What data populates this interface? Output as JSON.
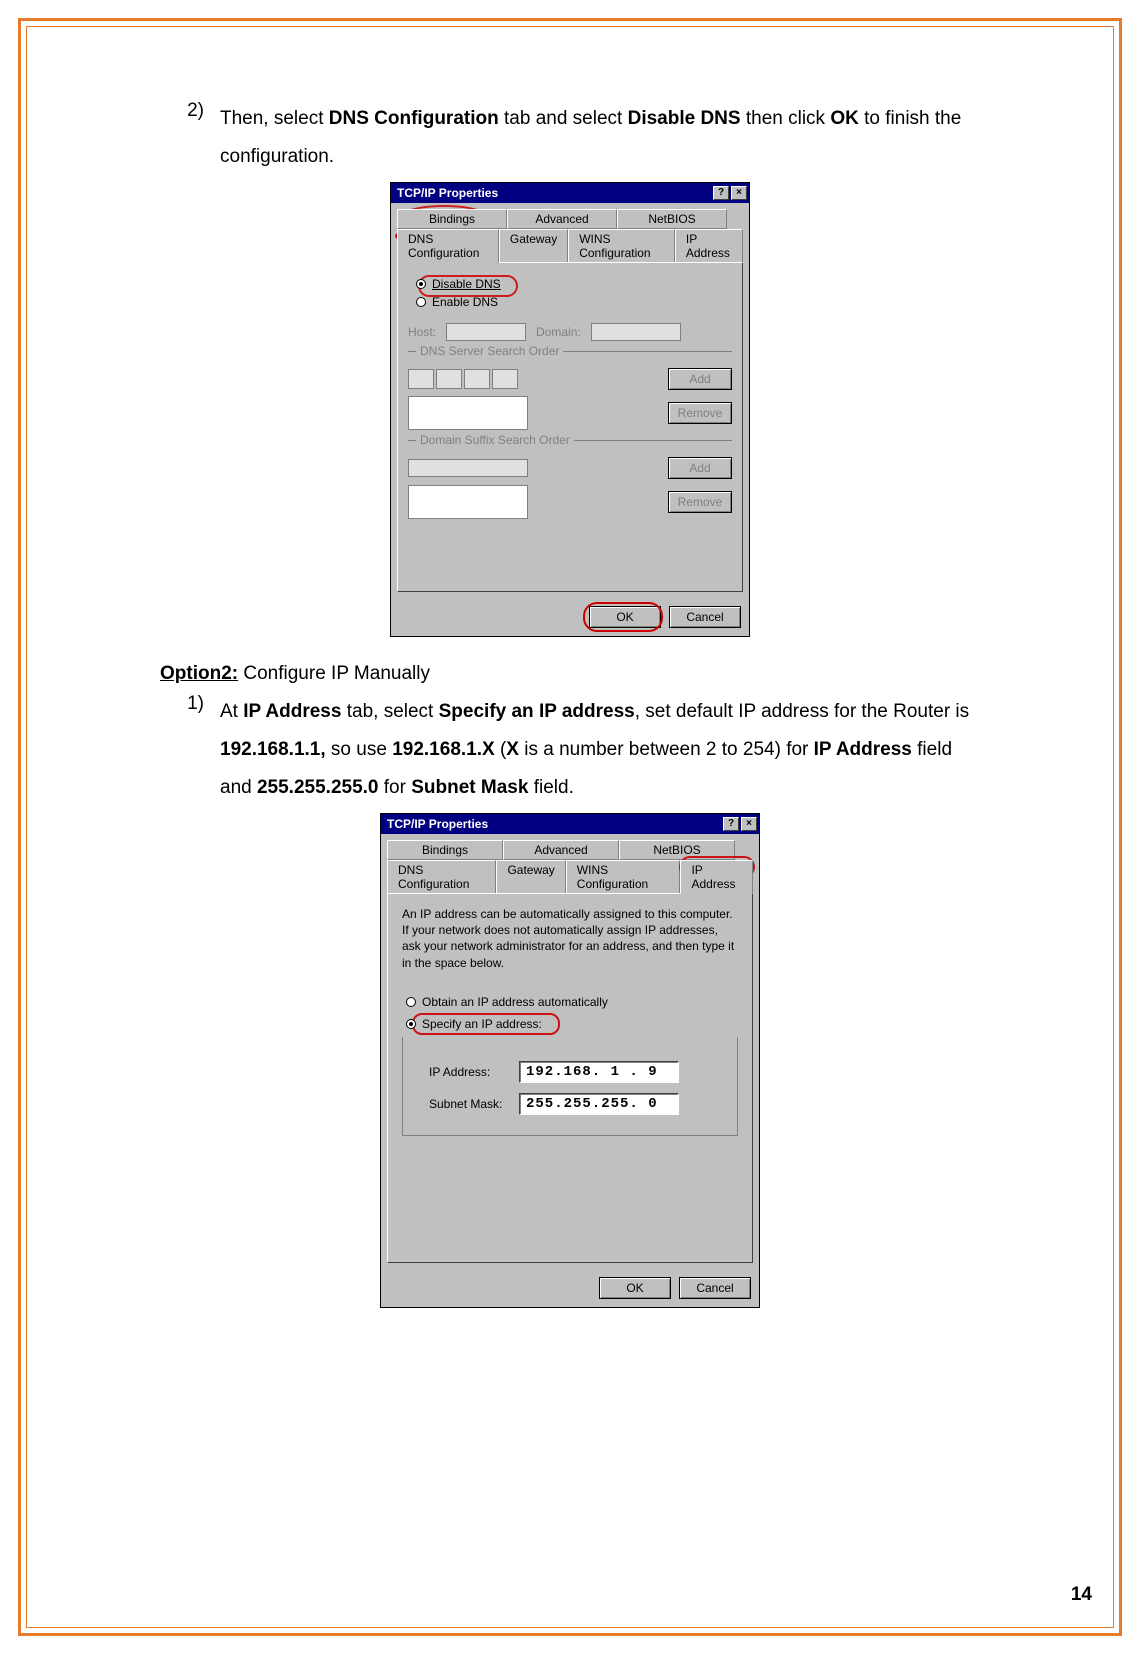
{
  "page_number": "14",
  "step2": {
    "num": "2)",
    "text_a": "Then, select ",
    "bold_a": "DNS Configuration",
    "text_b": " tab and select ",
    "bold_b": "Disable DNS",
    "text_c": " then click ",
    "bold_c": "OK",
    "text_d": " to finish the configuration."
  },
  "option2": {
    "label": "Option2:",
    "text": " Configure IP Manually"
  },
  "step1b": {
    "num": "1)",
    "t0": "At ",
    "b0": "IP Address",
    "t1": " tab, select ",
    "b1": "Specify an IP address",
    "t2": ", set default IP address for the Router is ",
    "b2": "192.168.1.1,",
    "t3": " so use ",
    "b3": "192.168.1.X",
    "t4": " (",
    "b4": "X",
    "t5": " is a number between 2 to 254) for ",
    "b5": "IP Address",
    "t6": " field and ",
    "b6": "255.255.255.0",
    "t7": " for ",
    "b7": "Subnet Mask",
    "t8": " field."
  },
  "dlg1": {
    "title": "TCP/IP Properties",
    "tabs_top": [
      "Bindings",
      "Advanced",
      "NetBIOS"
    ],
    "tabs_bottom": [
      "DNS Configuration",
      "Gateway",
      "WINS Configuration",
      "IP Address"
    ],
    "disable_dns": "Disable DNS",
    "enable_dns": "Enable DNS",
    "host": "Host:",
    "domain": "Domain:",
    "dns_order": "DNS Server Search Order",
    "suffix_order": "Domain Suffix Search Order",
    "add": "Add",
    "remove": "Remove",
    "ok": "OK",
    "cancel": "Cancel"
  },
  "dlg2": {
    "title": "TCP/IP Properties",
    "tabs_top": [
      "Bindings",
      "Advanced",
      "NetBIOS"
    ],
    "tabs_bottom": [
      "DNS Configuration",
      "Gateway",
      "WINS Configuration",
      "IP Address"
    ],
    "help": "An IP address can be automatically assigned to this computer. If your network does not automatically assign IP addresses, ask your network administrator for an address, and then type it in the space below.",
    "obtain": "Obtain an IP address automatically",
    "specify": "Specify an IP address:",
    "ip_label": "IP Address:",
    "subnet_label": "Subnet Mask:",
    "ip_value": "192.168. 1 . 9",
    "subnet_value": "255.255.255. 0",
    "ok": "OK",
    "cancel": "Cancel"
  }
}
